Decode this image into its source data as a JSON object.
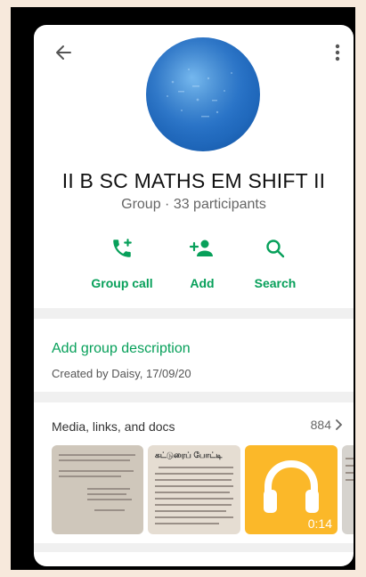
{
  "group": {
    "name": "II B SC MATHS EM SHIFT II",
    "meta": "Group · 33 participants"
  },
  "actions": [
    {
      "label": "Group call",
      "icon": "add-call-icon"
    },
    {
      "label": "Add",
      "icon": "add-person-icon"
    },
    {
      "label": "Search",
      "icon": "search-icon"
    }
  ],
  "description": {
    "link": "Add group description",
    "created_by": "Created by Daisy, 17/09/20"
  },
  "media": {
    "title": "Media, links, and docs",
    "count": "884",
    "items": [
      {
        "type": "image"
      },
      {
        "type": "image",
        "header": "கட்டுரைப் போட்டி"
      },
      {
        "type": "audio",
        "duration": "0:14",
        "icon": "headphones-icon"
      },
      {
        "type": "image"
      }
    ]
  },
  "colors": {
    "accent": "#07a05a",
    "audio_bg": "#fbb829",
    "avatar_blue": "#2a78cf"
  }
}
